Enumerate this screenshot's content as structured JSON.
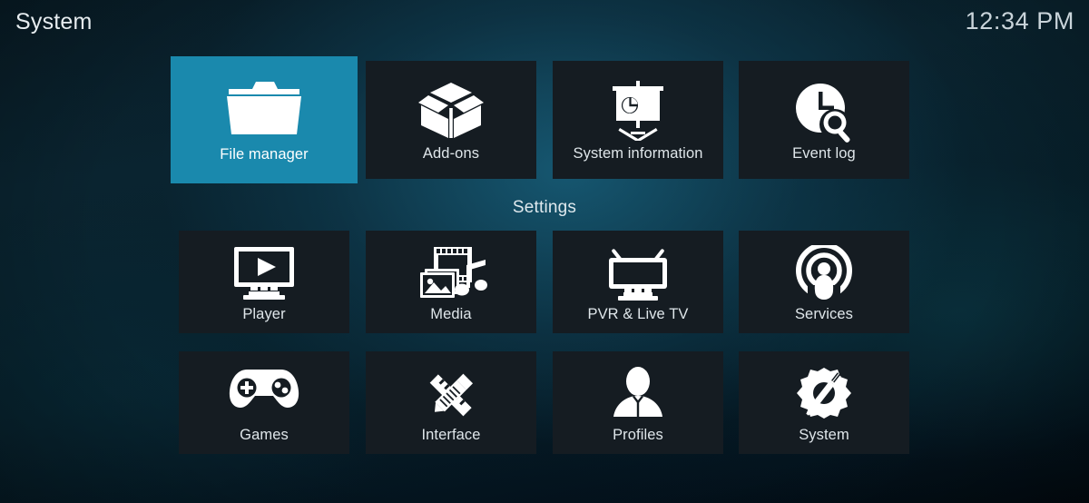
{
  "header": {
    "title": "System",
    "clock": "12:34 PM"
  },
  "section": {
    "label": "Settings"
  },
  "colors": {
    "selected_tile": "#1a89ad",
    "tile": "#151c22",
    "text": "#dfe6ea",
    "background": "#07202b"
  },
  "rows": [
    {
      "name": "top-row",
      "tiles": [
        {
          "label": "File manager",
          "icon": "folder-icon",
          "selected": true
        },
        {
          "label": "Add-ons",
          "icon": "open-box-icon",
          "selected": false
        },
        {
          "label": "System information",
          "icon": "presentation-icon",
          "selected": false
        },
        {
          "label": "Event log",
          "icon": "clock-search-icon",
          "selected": false
        }
      ]
    },
    {
      "name": "settings-row-1",
      "tiles": [
        {
          "label": "Player",
          "icon": "monitor-play-icon",
          "selected": false
        },
        {
          "label": "Media",
          "icon": "media-stack-icon",
          "selected": false
        },
        {
          "label": "PVR & Live TV",
          "icon": "tv-antenna-icon",
          "selected": false
        },
        {
          "label": "Services",
          "icon": "broadcast-icon",
          "selected": false
        }
      ]
    },
    {
      "name": "settings-row-2",
      "tiles": [
        {
          "label": "Games",
          "icon": "gamepad-icon",
          "selected": false
        },
        {
          "label": "Interface",
          "icon": "pencil-ruler-icon",
          "selected": false
        },
        {
          "label": "Profiles",
          "icon": "person-bust-icon",
          "selected": false
        },
        {
          "label": "System",
          "icon": "gear-wrench-icon",
          "selected": false
        }
      ]
    }
  ]
}
